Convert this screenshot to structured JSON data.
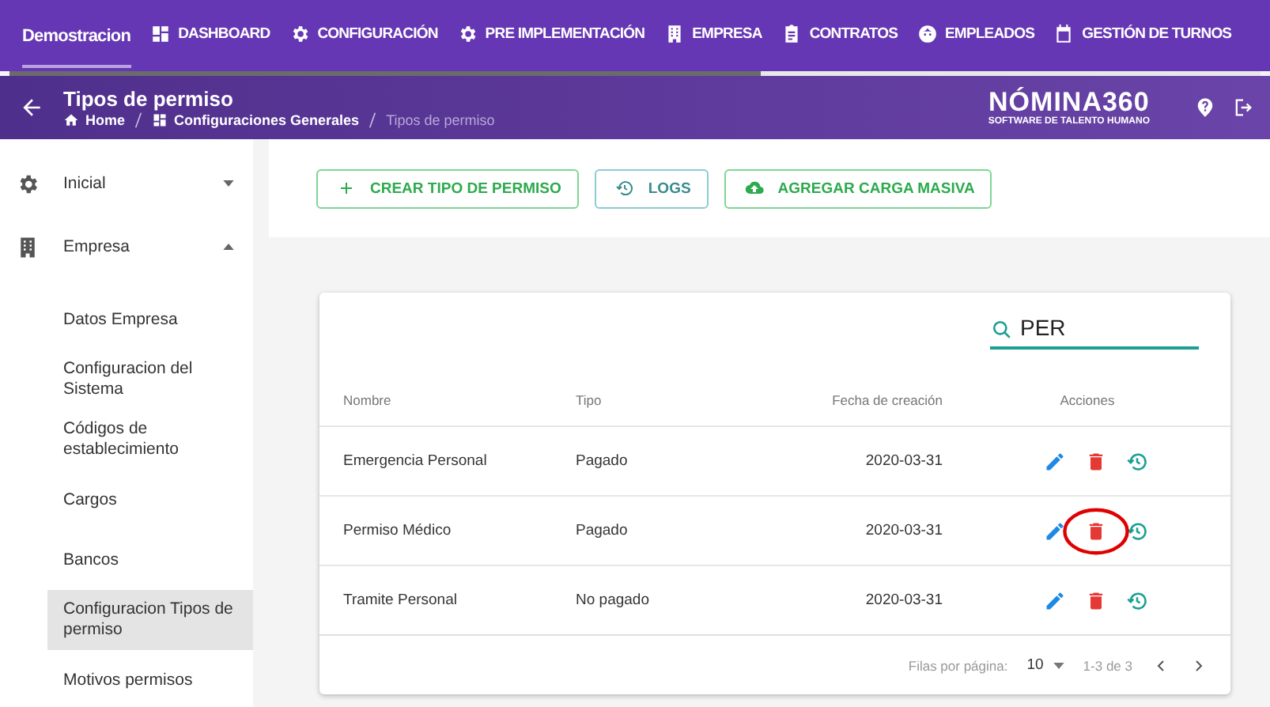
{
  "top_nav": {
    "brand": {
      "label": "Demostracion",
      "selected": true
    },
    "items": [
      {
        "label": "DASHBOARD",
        "selected": false
      },
      {
        "label": "CONFIGURACIÓN",
        "selected": false
      },
      {
        "label": "PRE IMPLEMENTACIÓN",
        "selected": false
      },
      {
        "label": "EMPRESA",
        "selected": false
      },
      {
        "label": "CONTRATOS",
        "selected": false
      },
      {
        "label": "EMPLEADOS",
        "selected": false
      },
      {
        "label": "GESTIÓN DE TURNOS",
        "selected": false
      }
    ]
  },
  "progress": {
    "level": 0.6
  },
  "header": {
    "title": "Tipos de permiso",
    "breadcrumbs": [
      "Home",
      "Configuraciones Generales",
      "Tipos de permiso"
    ],
    "logo": {
      "name": "NÓMINA360",
      "tagline": "SOFTWARE DE TALENTO HUMANO"
    }
  },
  "sidebar": {
    "items": [
      {
        "label": "Inicial",
        "expanded": false
      },
      {
        "label": "Empresa",
        "expanded": true,
        "children": [
          {
            "label": "Datos Empresa",
            "selected": false
          },
          {
            "label": "Configuracion del Sistema",
            "selected": false
          },
          {
            "label": "Códigos de establecimiento",
            "selected": false
          },
          {
            "label": "Cargos",
            "selected": false
          },
          {
            "label": "Bancos",
            "selected": false
          },
          {
            "label": "Configuracion Tipos de permiso",
            "selected": true
          },
          {
            "label": "Motivos permisos",
            "selected": false
          }
        ]
      }
    ]
  },
  "toolbar": [
    {
      "label": "CREAR TIPO DE PERMISO"
    },
    {
      "label": "LOGS"
    },
    {
      "label": "AGREGAR CARGA MASIVA"
    }
  ],
  "search": {
    "value": "PER"
  },
  "table": {
    "columns": [
      "Nombre",
      "Tipo",
      "Fecha de creación",
      "Acciones"
    ],
    "rows": [
      {
        "cells": [
          "Emergencia Personal",
          "Pagado",
          "2020-03-31"
        ],
        "highlighted": false
      },
      {
        "cells": [
          "Permiso Médico",
          "Pagado",
          "2020-03-31"
        ],
        "highlighted": true
      },
      {
        "cells": [
          "Tramite Personal",
          "No pagado",
          "2020-03-31"
        ],
        "highlighted": false
      }
    ]
  },
  "pagination": {
    "rows_label": "Filas por página:",
    "rows_value": "10",
    "range": "1-3 de 3"
  }
}
